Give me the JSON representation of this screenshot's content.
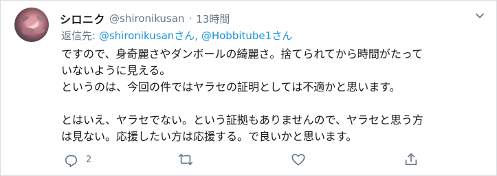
{
  "tweet": {
    "author_name": "シロニク",
    "author_handle": "@shironikusan",
    "separator": "·",
    "time": "13時間",
    "replying_label": "返信先:",
    "replying_mention_1": "@shironikusanさん",
    "replying_separator": ",",
    "replying_mention_2": "@Hobbitube1さん",
    "lines": [
      "ですので、身奇麗さやダンボールの綺麗さ。捨てられてから時間がたって",
      "いないように見える。",
      "というのは、今回の件ではヤラセの証明としては不適かと思います。",
      "",
      "とはいえ、ヤラセでない。という証拠もありませんので、ヤラセと思う方",
      "は見ない。応援したい方は応援する。で良いかと思います。"
    ],
    "reply_count": "2"
  },
  "icons": {
    "menu": "chevron-down-icon",
    "reply": "reply-icon",
    "retweet": "retweet-icon",
    "like": "heart-icon",
    "share": "share-icon"
  },
  "colors": {
    "text": "#14171a",
    "muted": "#657786",
    "link": "#1b95e0",
    "border": "#d8dde2"
  }
}
